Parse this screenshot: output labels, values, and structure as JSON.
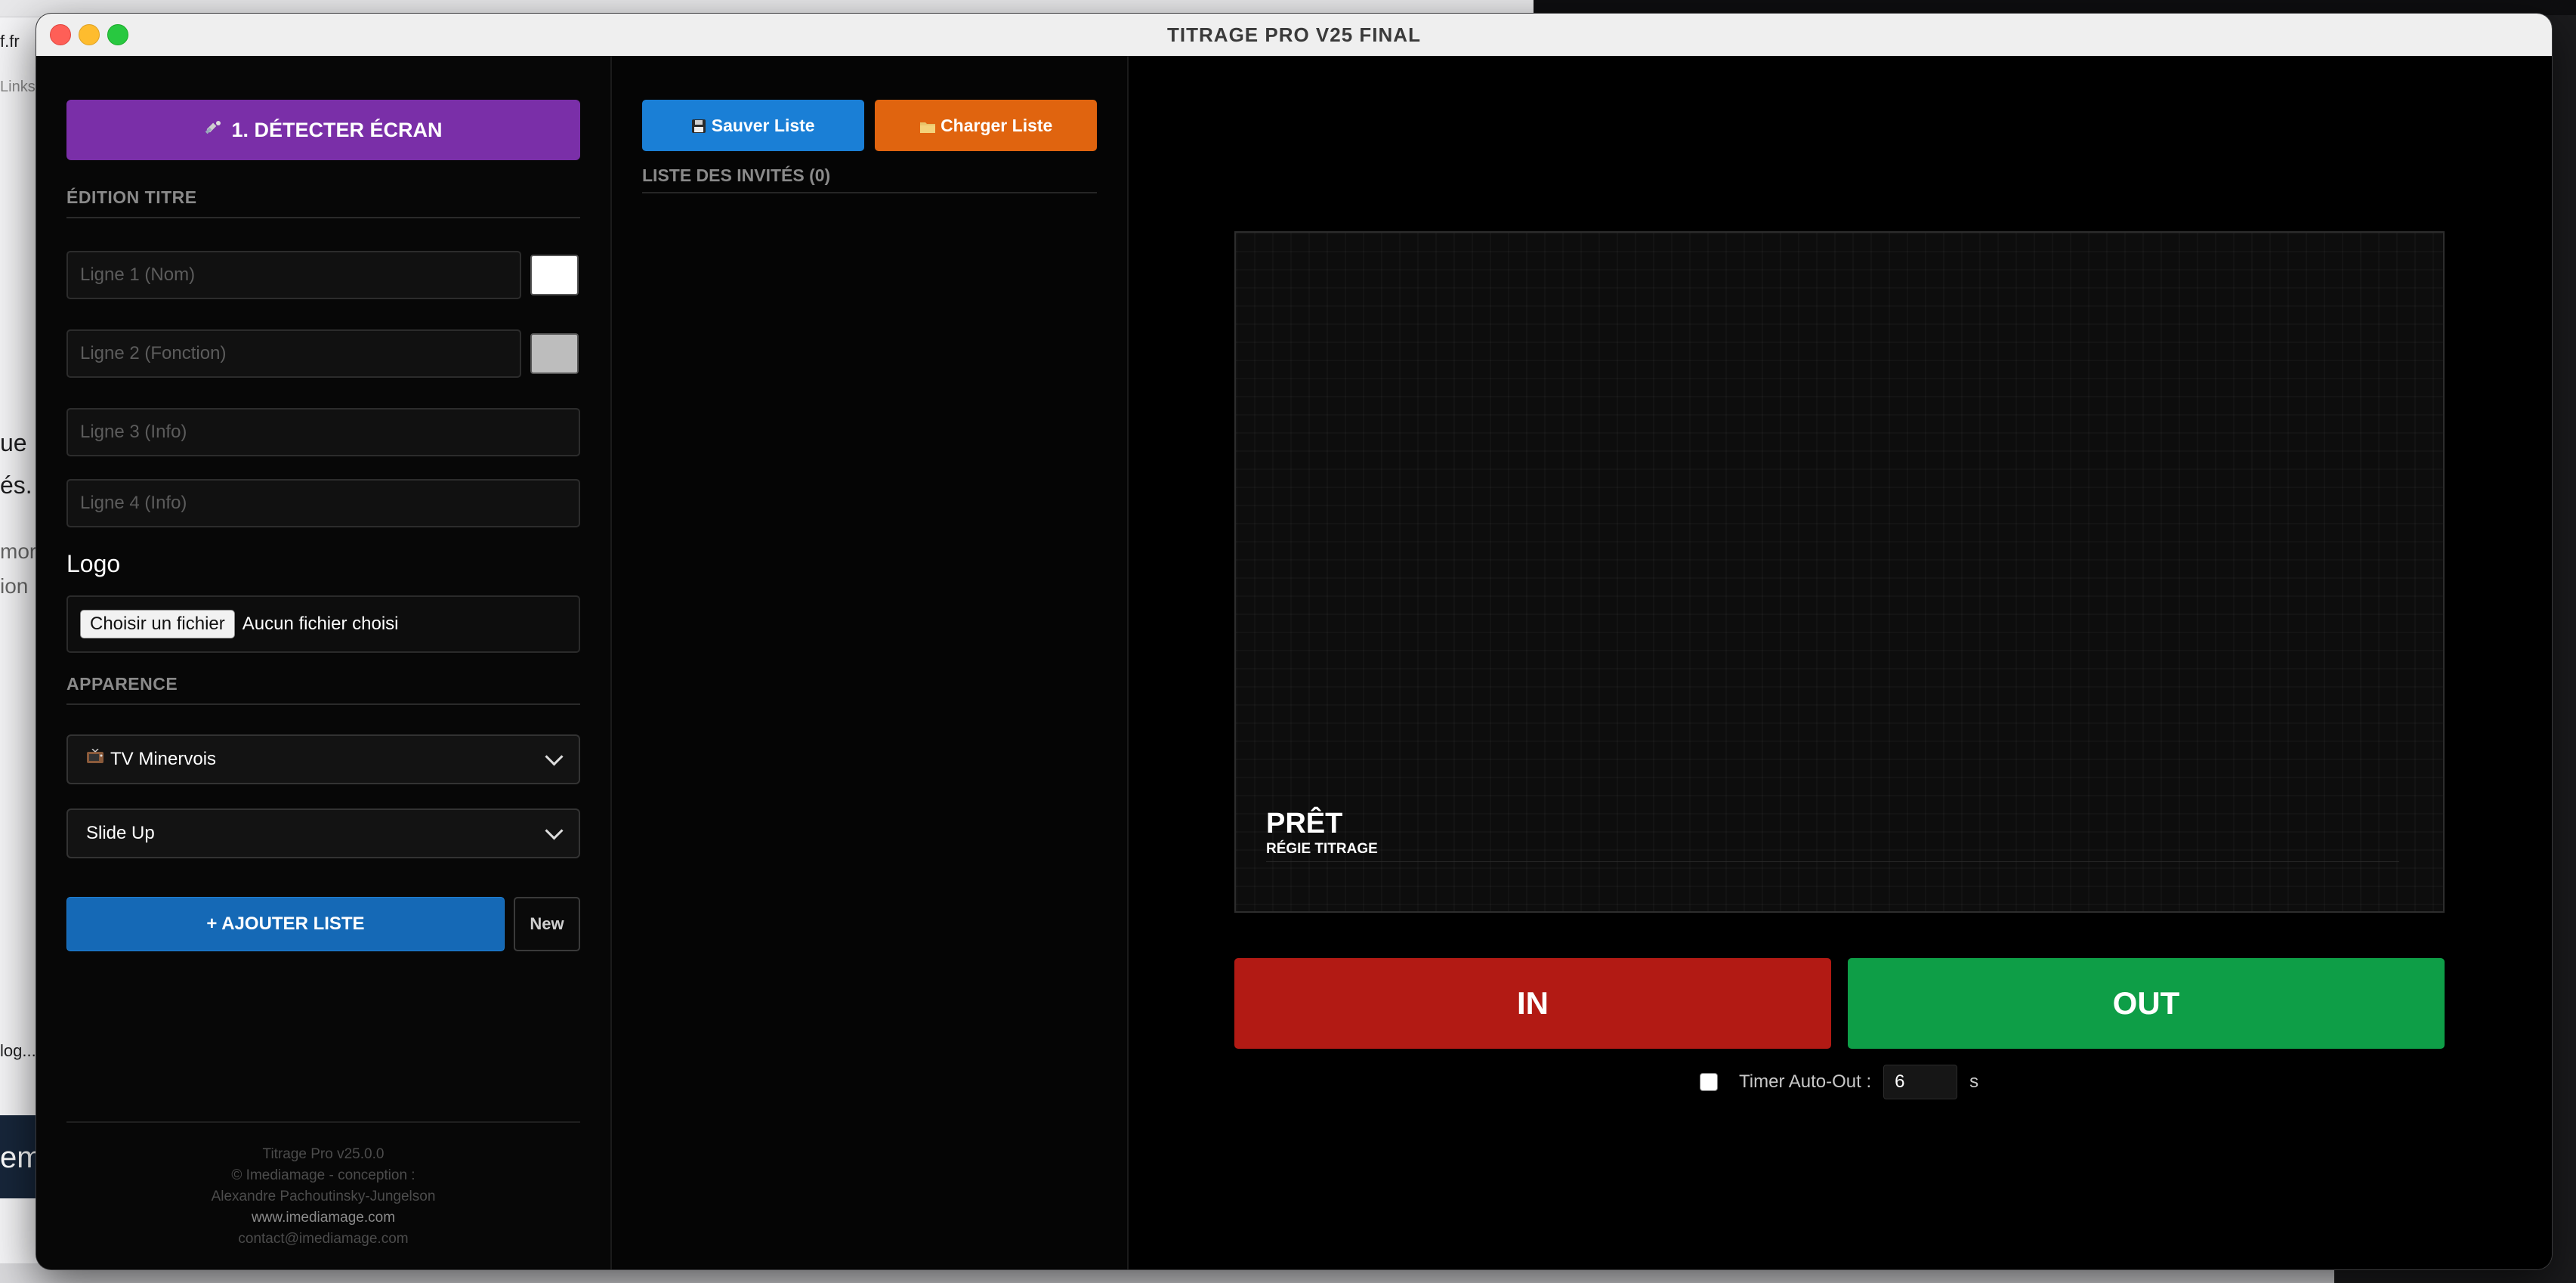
{
  "background": {
    "browser_fragments": [
      "f.fr",
      "Links",
      "ue",
      "és.",
      "mor",
      "ion",
      "log...",
      "em"
    ]
  },
  "window": {
    "title": "TITRAGE PRO V25 FINAL"
  },
  "left": {
    "detect_button": "1. DÉTECTER ÉCRAN",
    "detect_icon": "satellite-icon",
    "edit_section_title": "ÉDITION TITRE",
    "fields": [
      {
        "placeholder": "Ligne 1 (Nom)",
        "value": "",
        "color": "#ffffff"
      },
      {
        "placeholder": "Ligne 2 (Fonction)",
        "value": "",
        "color": "#bdbdbd"
      },
      {
        "placeholder": "Ligne 3 (Info)",
        "value": ""
      },
      {
        "placeholder": "Ligne 4 (Info)",
        "value": ""
      }
    ],
    "logo_label": "Logo",
    "file_button": "Choisir un fichier",
    "file_status": "Aucun fichier choisi",
    "appearance_section_title": "APPARENCE",
    "theme_select": {
      "icon": "tv-icon",
      "selected": "TV Minervois"
    },
    "animation_select": {
      "selected": "Slide Up"
    },
    "add_list_button": "+ AJOUTER LISTE",
    "new_button": "New",
    "footer": {
      "version": "Titrage Pro v25.0.0",
      "copyright": "© Imediamage - conception :",
      "author": "Alexandre Pachoutinsky-Jungelson",
      "website": "www.imediamage.com",
      "email": "contact@imediamage.com"
    }
  },
  "middle": {
    "save_button": "Sauver Liste",
    "save_icon": "floppy-disk-icon",
    "load_button": "Charger Liste",
    "load_icon": "folder-icon",
    "guest_list_title": "LISTE DES INVITÉS (0)",
    "guests": []
  },
  "right": {
    "preview": {
      "line1": "PRÊT",
      "line2": "RÉGIE TITRAGE"
    },
    "in_button": "IN",
    "out_button": "OUT",
    "timer": {
      "checked": false,
      "label": "Timer Auto-Out :",
      "value": "6",
      "unit": "s"
    }
  },
  "colors": {
    "detect": "#7a2fa8",
    "add_list": "#1569b6",
    "save": "#1a7fd6",
    "load": "#e0640f",
    "in": "#b21a14",
    "out": "#0e9e47"
  }
}
